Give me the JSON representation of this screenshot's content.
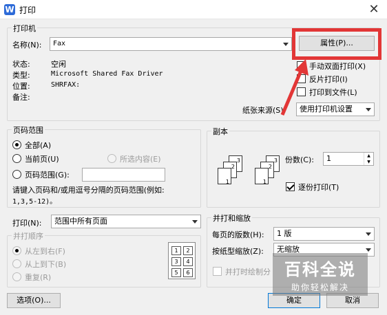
{
  "window": {
    "title": "打印",
    "icon": "wps-writer-icon",
    "close": "✕"
  },
  "printer": {
    "group_label": "打印机",
    "name_label": "名称(N):",
    "name_value": "Fax",
    "properties_button": "属性(P)...",
    "status_label": "状态:",
    "status_value": "空闲",
    "type_label": "类型:",
    "type_value": "Microsoft Shared Fax Driver",
    "location_label": "位置:",
    "location_value": "SHRFAX:",
    "comment_label": "备注:",
    "duplex_label": "手动双面打印(X)",
    "reverse_label": "反片打印(I)",
    "print_to_file_label": "打印到文件(L)",
    "paper_source_label": "纸张来源(S):",
    "paper_source_value": "使用打印机设置"
  },
  "page_range": {
    "group_label": "页码范围",
    "all": "全部(A)",
    "current": "当前页(U)",
    "selection": "所选内容(E)",
    "pages": "页码范围(G):",
    "pages_value": "",
    "hint_line1": "请键入页码和/或用逗号分隔的页码范围(例如:",
    "hint_line2": "1,3,5-12)。"
  },
  "print_what": {
    "label": "打印(N):",
    "value": "范围中所有页面"
  },
  "collate_order": {
    "group_label": "并打顺序",
    "left_to_right": "从左到右(F)",
    "top_to_bottom": "从上到下(B)",
    "repeat": "重复(R)",
    "grid_pages": [
      "1",
      "2",
      "3",
      "4",
      "5",
      "6"
    ]
  },
  "copies": {
    "group_label": "副本",
    "count_label": "份数(C):",
    "count_value": "1",
    "collate_label": "逐份打印(T)",
    "stack_pages": [
      "3",
      "2",
      "1"
    ]
  },
  "zoom": {
    "group_label": "并打和缩放",
    "pages_per_sheet_label": "每页的版数(H):",
    "pages_per_sheet_value": "1 版",
    "scale_label": "按纸型缩放(Z):",
    "scale_value": "无缩放",
    "draw_borders_label": "并打时绘制分"
  },
  "footer": {
    "options": "选项(O)...",
    "ok": "确定",
    "cancel": "取消"
  },
  "watermark": {
    "title": "百科全说",
    "subtitle": "助你轻松解决"
  },
  "colors": {
    "highlight": "#e23636",
    "title_icon": "#2e6bd8"
  }
}
